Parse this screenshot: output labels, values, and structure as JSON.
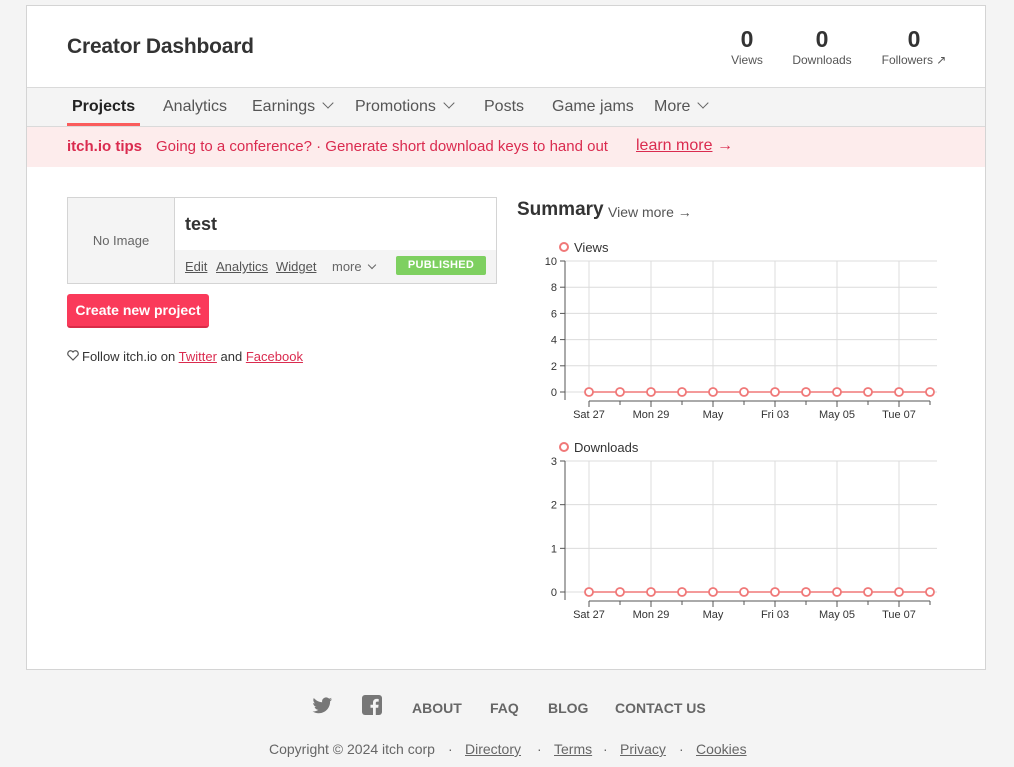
{
  "header": {
    "title": "Creator Dashboard"
  },
  "stats": [
    {
      "value": "0",
      "label": "Views"
    },
    {
      "value": "0",
      "label": "Downloads"
    },
    {
      "value": "0",
      "label": "Followers ↗"
    }
  ],
  "nav": [
    "Projects",
    "Analytics",
    "Earnings",
    "Promotions",
    "Posts",
    "Game jams",
    "More"
  ],
  "tips": {
    "label": "itch.io tips",
    "text": "Going to a conference? · Generate short download keys to hand out",
    "link": "learn more",
    "arrow": "→"
  },
  "project": {
    "no_image": "No Image",
    "title": "test",
    "links": [
      "Edit",
      "Analytics",
      "Widget"
    ],
    "more": "more",
    "status": "PUBLISHED"
  },
  "create_button": "Create new project",
  "follow": {
    "prefix": "Follow itch.io on",
    "twitter": "Twitter",
    "and": "and",
    "facebook": "Facebook"
  },
  "summary": {
    "title": "Summary",
    "view_more": "View more →"
  },
  "chart_data": [
    {
      "type": "line",
      "title": "Views",
      "x": [
        "Sat 27",
        "Mon 29",
        "May",
        "Fri 03",
        "May 05",
        "Tue 07"
      ],
      "yticks": [
        0,
        2,
        4,
        6,
        8,
        10
      ],
      "ylim": [
        0,
        10
      ],
      "series": [
        {
          "name": "Views",
          "values": [
            0,
            0,
            0,
            0,
            0,
            0,
            0,
            0,
            0,
            0,
            0,
            0
          ]
        }
      ],
      "color": "#f07878"
    },
    {
      "type": "line",
      "title": "Downloads",
      "x": [
        "Sat 27",
        "Mon 29",
        "May",
        "Fri 03",
        "May 05",
        "Tue 07"
      ],
      "yticks": [
        0,
        1,
        2,
        3
      ],
      "ylim": [
        0,
        3
      ],
      "series": [
        {
          "name": "Downloads",
          "values": [
            0,
            0,
            0,
            0,
            0,
            0,
            0,
            0,
            0,
            0,
            0,
            0
          ]
        }
      ],
      "color": "#f07878"
    }
  ],
  "footer": {
    "icons": [
      "twitter-icon",
      "facebook-icon"
    ],
    "links": [
      "ABOUT",
      "FAQ",
      "BLOG",
      "CONTACT US"
    ],
    "copyright": "Copyright © 2024 itch corp",
    "legal": [
      "Directory",
      "Terms",
      "Privacy",
      "Cookies"
    ]
  }
}
